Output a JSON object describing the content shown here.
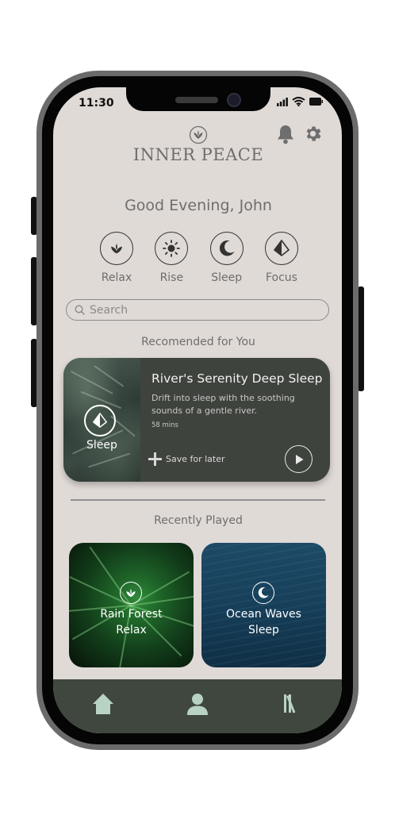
{
  "status_bar": {
    "time": "11:30"
  },
  "header": {
    "app_title": "INNER PEACE"
  },
  "greeting": "Good Evening, John",
  "categories": [
    {
      "label": "Relax",
      "icon": "lotus-icon"
    },
    {
      "label": "Rise",
      "icon": "sun-icon"
    },
    {
      "label": "Sleep",
      "icon": "moon-icon"
    },
    {
      "label": "Focus",
      "icon": "diamond-icon"
    }
  ],
  "search": {
    "placeholder": "Search"
  },
  "recommended": {
    "section_title": "Recomended for You",
    "card": {
      "category_label": "Sleep",
      "title": "River's Serenity Deep Sleep",
      "description": "Drift into sleep with the soothing sounds of a gentle river.",
      "duration": "58 mins",
      "save_label": "Save for later"
    }
  },
  "recently_played": {
    "section_title": "Recently Played",
    "items": [
      {
        "title": "Rain Forest",
        "category": "Relax",
        "icon": "lotus-icon"
      },
      {
        "title": "Ocean Waves",
        "category": "Sleep",
        "icon": "moon-icon"
      }
    ]
  },
  "tabs": [
    {
      "name": "home",
      "icon": "home-icon"
    },
    {
      "name": "profile",
      "icon": "person-icon"
    },
    {
      "name": "library",
      "icon": "library-icon"
    }
  ],
  "colors": {
    "background": "#e0dad7",
    "card": "#3f433d",
    "tabbar": "#3f473f",
    "tab_icon": "#b9d3c3",
    "text": "#6e6e6e"
  }
}
